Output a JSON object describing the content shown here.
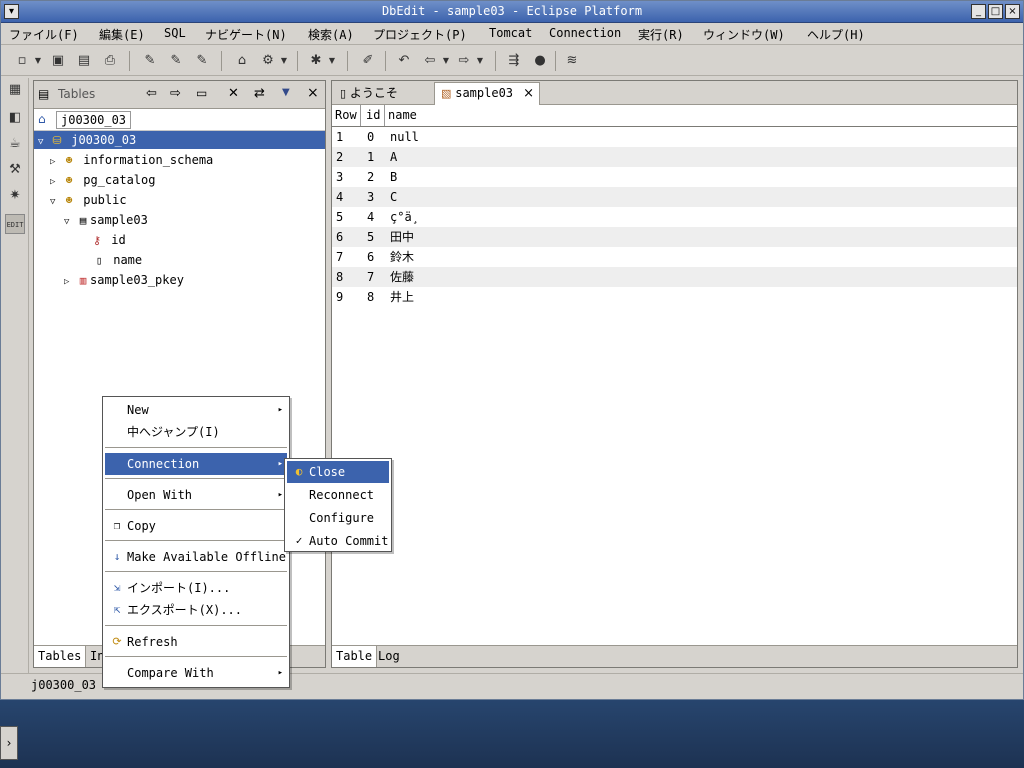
{
  "window": {
    "title": "DbEdit - sample03 - Eclipse Platform"
  },
  "menu": [
    "ファイル(F)",
    "編集(E)",
    "SQL",
    "ナビゲート(N)",
    "検索(A)",
    "プロジェクト(P)",
    "Tomcat",
    "Connection",
    "実行(R)",
    "ウィンドウ(W)",
    "ヘルプ(H)"
  ],
  "left_panel": {
    "title": "Tables",
    "breadcrumb": "j00300_03",
    "tree": [
      {
        "label": "j00300_03",
        "icon": "database-icon",
        "selected": true
      },
      {
        "label": "information_schema",
        "icon": "schema-icon"
      },
      {
        "label": "pg_catalog",
        "icon": "schema-icon"
      },
      {
        "label": "public",
        "icon": "schema-icon"
      },
      {
        "label": "sample03",
        "icon": "table-icon"
      },
      {
        "label": "id",
        "icon": "primary-key-column-icon"
      },
      {
        "label": "name",
        "icon": "column-icon"
      },
      {
        "label": "sample03_pkey",
        "icon": "index-icon"
      }
    ],
    "footer_tabs": [
      "Tables",
      "In"
    ]
  },
  "editor": {
    "tabs": [
      {
        "label": "ようこそ",
        "icon": "page-icon"
      },
      {
        "label": "sample03",
        "icon": "table-edit-icon",
        "active": true
      }
    ],
    "columns": [
      "Row",
      "id",
      "name"
    ],
    "rows": [
      [
        "1",
        "0",
        "null"
      ],
      [
        "2",
        "1",
        "A"
      ],
      [
        "3",
        "2",
        "B"
      ],
      [
        "4",
        "3",
        "C"
      ],
      [
        "5",
        "4",
        "ç°ä¸"
      ],
      [
        "6",
        "5",
        "田中"
      ],
      [
        "7",
        "6",
        "鈴木"
      ],
      [
        "8",
        "7",
        "佐藤"
      ],
      [
        "9",
        "8",
        "井上"
      ]
    ],
    "footer_tabs": [
      "Table",
      "Log"
    ]
  },
  "context_menu": {
    "items": [
      "New",
      "中へジャンプ(I)",
      "Connection",
      "Open With",
      "Copy",
      "Make Available Offline",
      "インポート(I)...",
      "エクスポート(X)...",
      "Refresh",
      "Compare With"
    ]
  },
  "submenu": {
    "items": [
      "Close",
      "Reconnect",
      "Configure",
      "Auto Commit"
    ],
    "check": "✓"
  },
  "status": {
    "text": "j00300_03"
  }
}
